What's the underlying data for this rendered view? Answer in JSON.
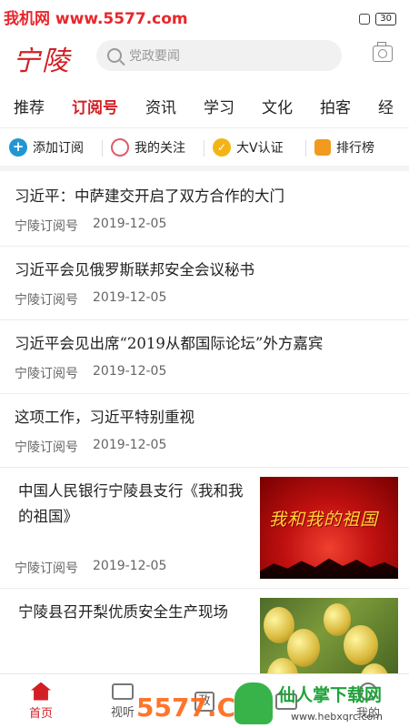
{
  "watermark": {
    "top_left": "我机网 www.5577.com",
    "bottom_center": "5577.C",
    "bottom_right": "仙人掌下载网",
    "bottom_url": "www.hebxqrc.com"
  },
  "status": {
    "battery": "30"
  },
  "header": {
    "logo": "宁陵",
    "search_placeholder": "党政要闻"
  },
  "tabs": [
    "推荐",
    "订阅号",
    "资讯",
    "学习",
    "文化",
    "拍客",
    "经"
  ],
  "active_tab": "订阅号",
  "subnav": [
    {
      "label": "添加订阅",
      "icon": "plus-icon"
    },
    {
      "label": "我的关注",
      "icon": "heart-icon"
    },
    {
      "label": "大V认证",
      "icon": "v-badge-icon"
    },
    {
      "label": "排行榜",
      "icon": "ranking-icon"
    }
  ],
  "feed": [
    {
      "title": "习近平：中萨建交开启了双方合作的大门",
      "source": "宁陵订阅号",
      "date": "2019-12-05"
    },
    {
      "title": "习近平会见俄罗斯联邦安全会议秘书",
      "source": "宁陵订阅号",
      "date": "2019-12-05"
    },
    {
      "title": "习近平会见出席“2019从都国际论坛”外方嘉宾",
      "source": "宁陵订阅号",
      "date": "2019-12-05"
    },
    {
      "title": "这项工作，习近平特别重视",
      "source": "宁陵订阅号",
      "date": "2019-12-05"
    },
    {
      "title": "中国人民银行宁陵县支行《我和我的祖国》",
      "source": "宁陵订阅号",
      "date": "2019-12-05",
      "thumb_text": "我和我的祖国"
    },
    {
      "title": "宁陵县召开梨优质安全生产现场",
      "source": "",
      "date": ""
    }
  ],
  "bottom_nav": [
    {
      "label": "首页",
      "icon": "home-icon",
      "active": true
    },
    {
      "label": "视听",
      "icon": "tv-icon"
    },
    {
      "label": "政",
      "icon": "government-icon"
    },
    {
      "label": "",
      "icon": "notification-icon"
    },
    {
      "label": "我的",
      "icon": "person-icon"
    }
  ],
  "colors": {
    "accent": "#d21f25"
  }
}
